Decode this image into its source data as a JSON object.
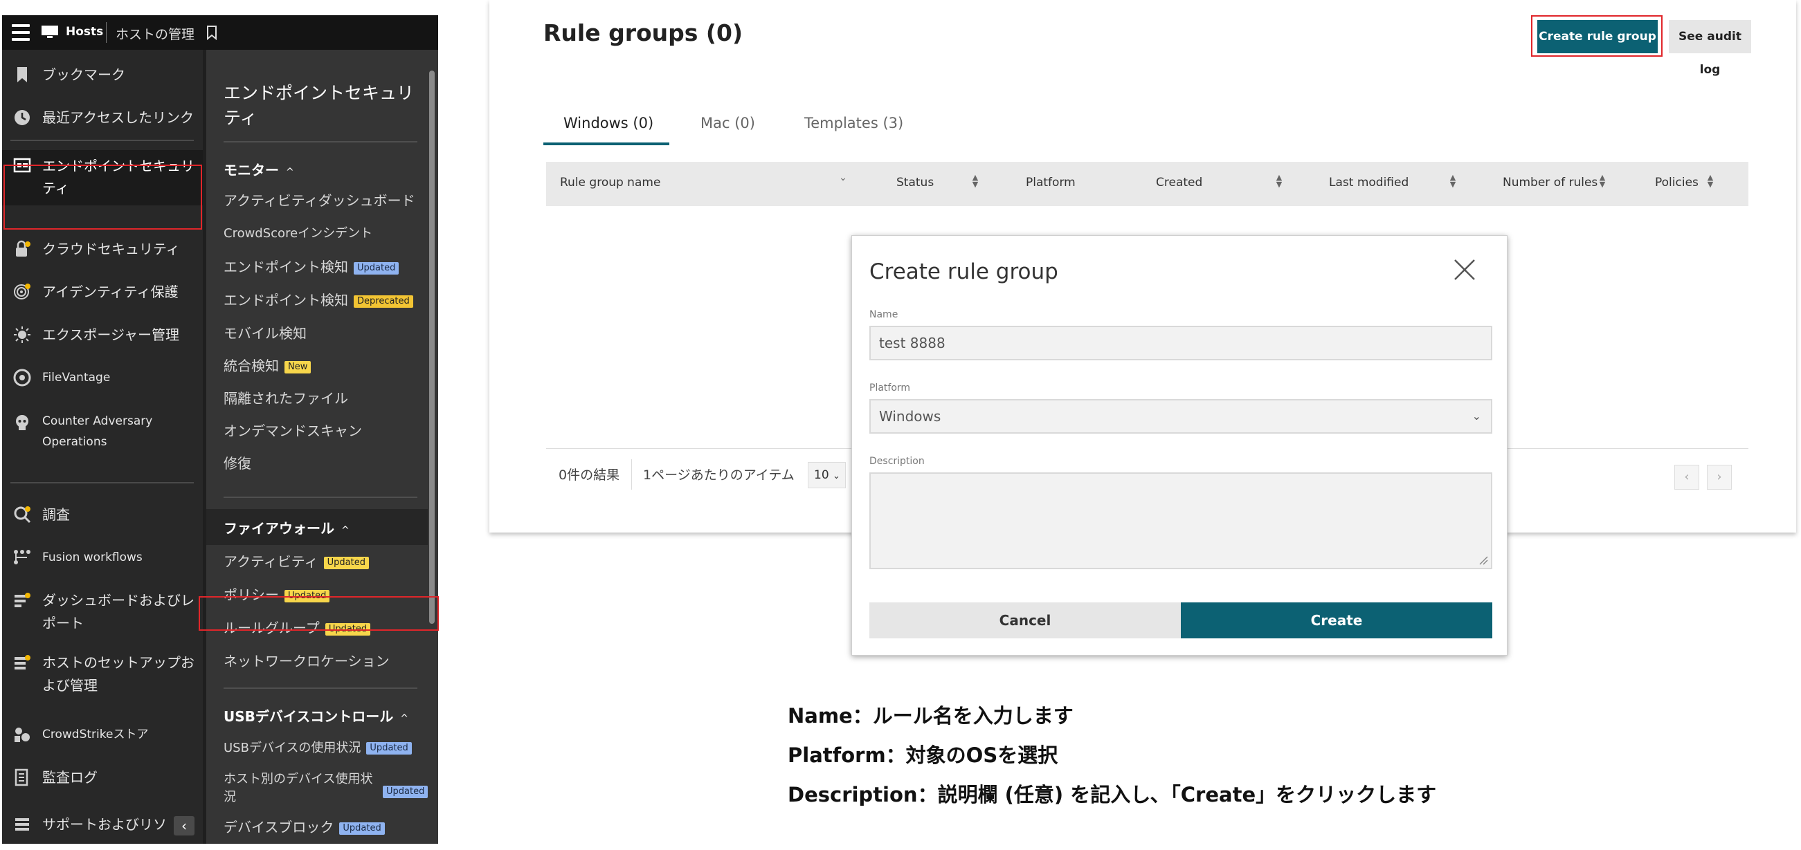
{
  "topbar": {
    "app": "Hosts",
    "section": "ホストの管理"
  },
  "nav": {
    "items": [
      {
        "label": "ブックマーク",
        "icon": "bookmark-icon"
      },
      {
        "label": "最近アクセスしたリンク",
        "icon": "clock-icon"
      },
      {
        "label": "エンドポイントセキュリティ",
        "icon": "endpoint-icon"
      },
      {
        "label": "クラウドセキュリティ",
        "icon": "cloud-lock-icon"
      },
      {
        "label": "アイデンティティ保護",
        "icon": "fingerprint-icon"
      },
      {
        "label": "エクスポージャー管理",
        "icon": "sun-icon"
      },
      {
        "label": "FileVantage",
        "icon": "aperture-icon"
      },
      {
        "label": "Counter Adversary Operations",
        "icon": "skull-icon"
      },
      {
        "label": "調査",
        "icon": "investigate-icon"
      },
      {
        "label": "Fusion workflows",
        "icon": "workflow-icon"
      },
      {
        "label": "ダッシュボードおよびレポート",
        "icon": "dashboard-icon"
      },
      {
        "label": "ホストのセットアップおよび管理",
        "icon": "host-setup-icon"
      },
      {
        "label": "CrowdStrikeストア",
        "icon": "store-icon"
      },
      {
        "label": "監査ログ",
        "icon": "audit-log-icon"
      },
      {
        "label": "サポートおよびリソース",
        "icon": "support-icon"
      }
    ]
  },
  "submenu": {
    "title": "エンドポイントセキュリティ",
    "monitor": {
      "header": "モニター",
      "items": [
        {
          "label": "アクティビティダッシュボード",
          "badge": ""
        },
        {
          "label": "CrowdScoreインシデント",
          "badge": ""
        },
        {
          "label": "エンドポイント検知",
          "badge": "Updated"
        },
        {
          "label": "エンドポイント検知",
          "badge": "Deprecated"
        },
        {
          "label": "モバイル検知",
          "badge": ""
        },
        {
          "label": "統合検知",
          "badge": "New"
        },
        {
          "label": "隔離されたファイル",
          "badge": ""
        },
        {
          "label": "オンデマンドスキャン",
          "badge": ""
        },
        {
          "label": "修復",
          "badge": ""
        }
      ]
    },
    "firewall": {
      "header": "ファイアウォール",
      "items": [
        {
          "label": "アクティビティ",
          "badge": "Updated"
        },
        {
          "label": "ポリシー",
          "badge": "Updated"
        },
        {
          "label": "ルールグループ",
          "badge": "Updated"
        },
        {
          "label": "ネットワークロケーション",
          "badge": ""
        }
      ]
    },
    "usb": {
      "header": "USBデバイスコントロール",
      "items": [
        {
          "label": "USBデバイスの使用状況",
          "badge": "Updated"
        },
        {
          "label": "ホスト別のデバイス使用状況",
          "badge": "Updated"
        },
        {
          "label": "デバイスブロック",
          "badge": "Updated"
        }
      ]
    }
  },
  "main": {
    "title": "Rule groups (0)",
    "create_button": "Create rule group",
    "audit_button": "See audit log",
    "tabs": [
      "Windows (0)",
      "Mac (0)",
      "Templates (3)"
    ],
    "columns": [
      "Rule group name",
      "Status",
      "Platform",
      "Created",
      "Last modified",
      "Number of rules",
      "Policies"
    ],
    "results": "0件の結果",
    "per_page_label": "1ページあたりのアイテム",
    "per_page_value": "10"
  },
  "modal": {
    "title": "Create rule group",
    "name_label": "Name",
    "name_value": "test 8888",
    "platform_label": "Platform",
    "platform_value": "Windows",
    "description_label": "Description",
    "cancel": "Cancel",
    "create": "Create"
  },
  "notes": [
    "Name：ルール名を入力します",
    "Platform：対象のOSを選択",
    "Description：説明欄 (任意) を記入し､「Create」をクリックします"
  ],
  "colors": {
    "accent": "#0c6173",
    "highlight": "#e0262a",
    "nav_bg": "#282828"
  }
}
